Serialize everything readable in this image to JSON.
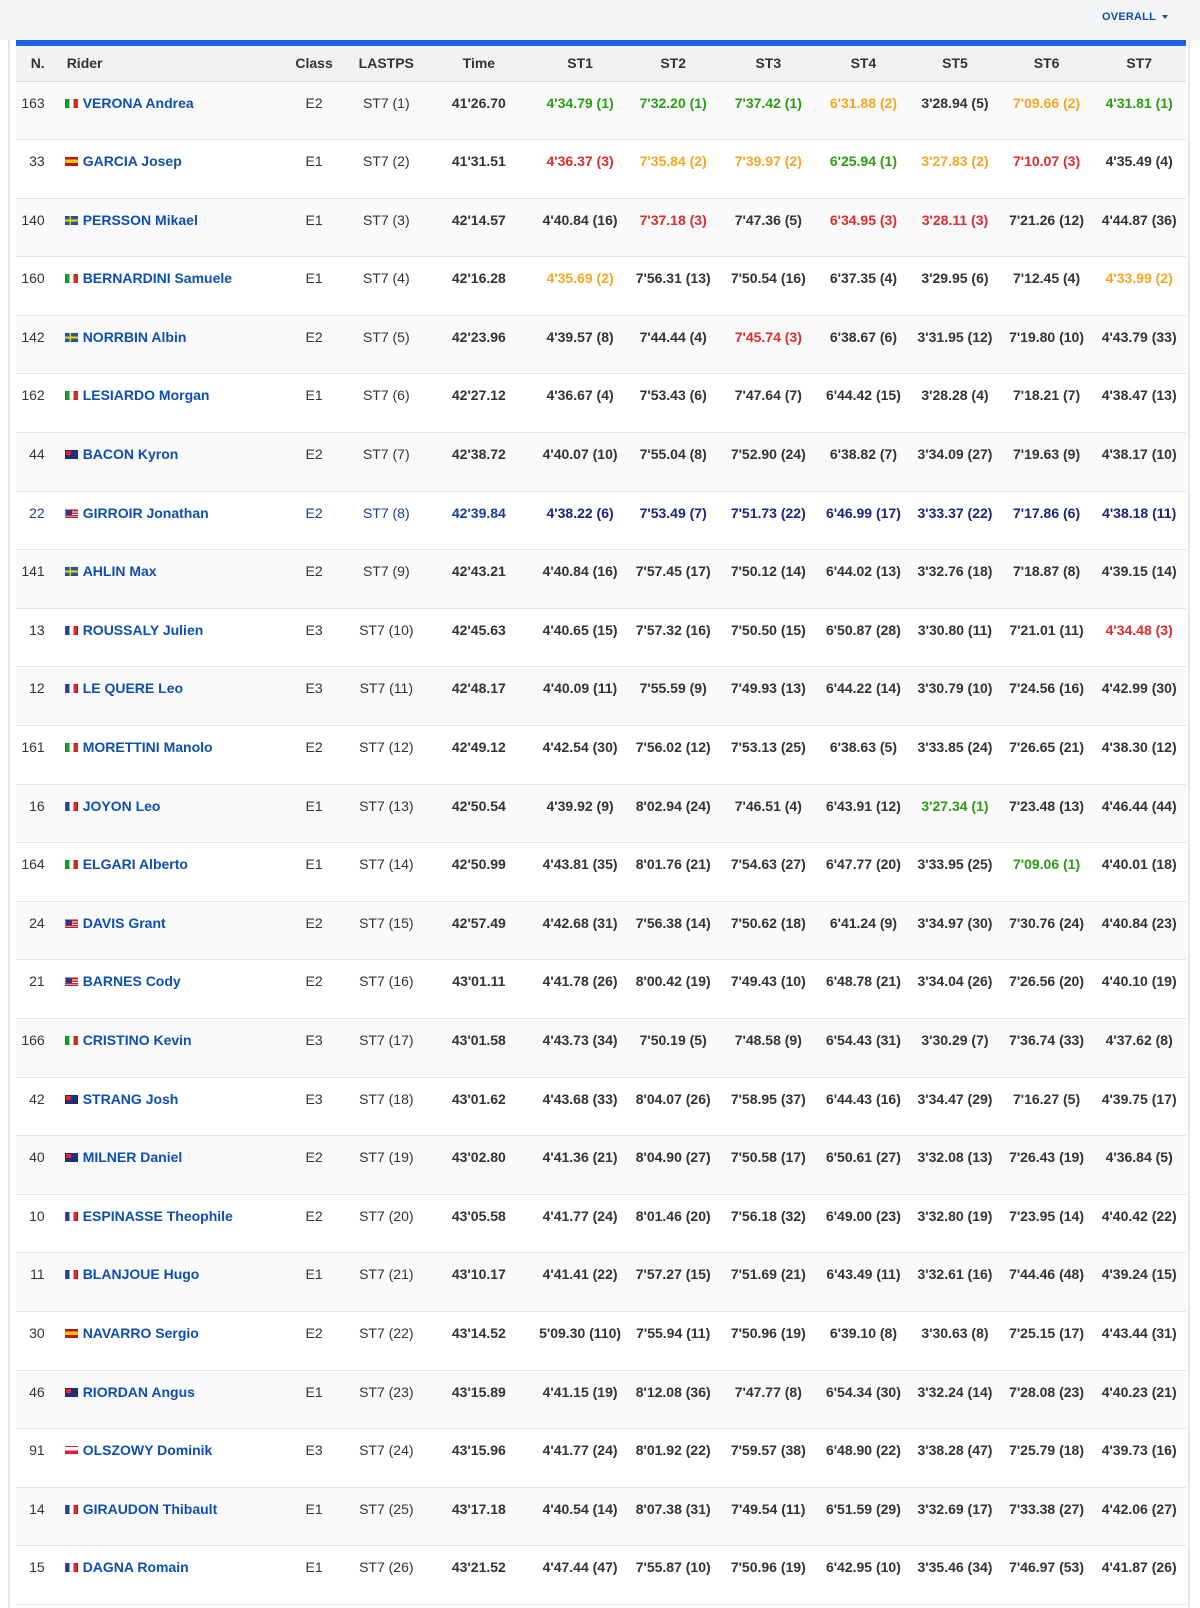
{
  "header": {
    "overall_label": "OVERALL"
  },
  "colors": {
    "accent": "#1c62e6",
    "link": "#0d4fb0",
    "first": "#2a9d12",
    "second": "#f5a623",
    "third": "#e02b2b",
    "highlight": "#1a237e"
  },
  "columns": [
    "N.",
    "Rider",
    "Class",
    "LASTPS",
    "Time",
    "ST1",
    "ST2",
    "ST3",
    "ST4",
    "ST5",
    "ST6",
    "ST7"
  ],
  "rows": [
    {
      "num": "163",
      "flag": "it",
      "rider": "VERONA Andrea",
      "cls": "E2",
      "lastps": "ST7 (1)",
      "time": "41'26.70",
      "st": [
        {
          "t": "4'34.79 (1)",
          "c": "green"
        },
        {
          "t": "7'32.20 (1)",
          "c": "green"
        },
        {
          "t": "7'37.42 (1)",
          "c": "green"
        },
        {
          "t": "6'31.88 (2)",
          "c": "orange"
        },
        {
          "t": "3'28.94 (5)",
          "c": ""
        },
        {
          "t": "7'09.66 (2)",
          "c": "orange"
        },
        {
          "t": "4'31.81 (1)",
          "c": "green"
        }
      ]
    },
    {
      "num": "33",
      "flag": "es",
      "rider": "GARCIA Josep",
      "cls": "E1",
      "lastps": "ST7 (2)",
      "time": "41'31.51",
      "st": [
        {
          "t": "4'36.37 (3)",
          "c": "red"
        },
        {
          "t": "7'35.84 (2)",
          "c": "orange"
        },
        {
          "t": "7'39.97 (2)",
          "c": "orange"
        },
        {
          "t": "6'25.94 (1)",
          "c": "green"
        },
        {
          "t": "3'27.83 (2)",
          "c": "orange"
        },
        {
          "t": "7'10.07 (3)",
          "c": "red"
        },
        {
          "t": "4'35.49 (4)",
          "c": ""
        }
      ]
    },
    {
      "num": "140",
      "flag": "se",
      "rider": "PERSSON Mikael",
      "cls": "E1",
      "lastps": "ST7 (3)",
      "time": "42'14.57",
      "st": [
        {
          "t": "4'40.84 (16)",
          "c": ""
        },
        {
          "t": "7'37.18 (3)",
          "c": "red"
        },
        {
          "t": "7'47.36 (5)",
          "c": ""
        },
        {
          "t": "6'34.95 (3)",
          "c": "red"
        },
        {
          "t": "3'28.11 (3)",
          "c": "red"
        },
        {
          "t": "7'21.26 (12)",
          "c": ""
        },
        {
          "t": "4'44.87 (36)",
          "c": ""
        }
      ]
    },
    {
      "num": "160",
      "flag": "it",
      "rider": "BERNARDINI Samuele",
      "cls": "E1",
      "lastps": "ST7 (4)",
      "time": "42'16.28",
      "st": [
        {
          "t": "4'35.69 (2)",
          "c": "orange"
        },
        {
          "t": "7'56.31 (13)",
          "c": ""
        },
        {
          "t": "7'50.54 (16)",
          "c": ""
        },
        {
          "t": "6'37.35 (4)",
          "c": ""
        },
        {
          "t": "3'29.95 (6)",
          "c": ""
        },
        {
          "t": "7'12.45 (4)",
          "c": ""
        },
        {
          "t": "4'33.99 (2)",
          "c": "orange"
        }
      ]
    },
    {
      "num": "142",
      "flag": "se",
      "rider": "NORRBIN Albin",
      "cls": "E2",
      "lastps": "ST7 (5)",
      "time": "42'23.96",
      "st": [
        {
          "t": "4'39.57 (8)",
          "c": ""
        },
        {
          "t": "7'44.44 (4)",
          "c": ""
        },
        {
          "t": "7'45.74 (3)",
          "c": "red"
        },
        {
          "t": "6'38.67 (6)",
          "c": ""
        },
        {
          "t": "3'31.95 (12)",
          "c": ""
        },
        {
          "t": "7'19.80 (10)",
          "c": ""
        },
        {
          "t": "4'43.79 (33)",
          "c": ""
        }
      ]
    },
    {
      "num": "162",
      "flag": "it",
      "rider": "LESIARDO Morgan",
      "cls": "E1",
      "lastps": "ST7 (6)",
      "time": "42'27.12",
      "st": [
        {
          "t": "4'36.67 (4)",
          "c": ""
        },
        {
          "t": "7'53.43 (6)",
          "c": ""
        },
        {
          "t": "7'47.64 (7)",
          "c": ""
        },
        {
          "t": "6'44.42 (15)",
          "c": ""
        },
        {
          "t": "3'28.28 (4)",
          "c": ""
        },
        {
          "t": "7'18.21 (7)",
          "c": ""
        },
        {
          "t": "4'38.47 (13)",
          "c": ""
        }
      ]
    },
    {
      "num": "44",
      "flag": "au",
      "rider": "BACON Kyron",
      "cls": "E2",
      "lastps": "ST7 (7)",
      "time": "42'38.72",
      "st": [
        {
          "t": "4'40.07 (10)",
          "c": ""
        },
        {
          "t": "7'55.04 (8)",
          "c": ""
        },
        {
          "t": "7'52.90 (24)",
          "c": ""
        },
        {
          "t": "6'38.82 (7)",
          "c": ""
        },
        {
          "t": "3'34.09 (27)",
          "c": ""
        },
        {
          "t": "7'19.63 (9)",
          "c": ""
        },
        {
          "t": "4'38.17 (10)",
          "c": ""
        }
      ]
    },
    {
      "num": "22",
      "flag": "us",
      "rider": "GIRROIR Jonathan",
      "cls": "E2",
      "lastps": "ST7 (8)",
      "time": "42'39.84",
      "highlight": true,
      "st": [
        {
          "t": "4'38.22 (6)",
          "c": "navy"
        },
        {
          "t": "7'53.49 (7)",
          "c": "navy"
        },
        {
          "t": "7'51.73 (22)",
          "c": "navy"
        },
        {
          "t": "6'46.99 (17)",
          "c": "navy"
        },
        {
          "t": "3'33.37 (22)",
          "c": "navy"
        },
        {
          "t": "7'17.86 (6)",
          "c": "navy"
        },
        {
          "t": "4'38.18 (11)",
          "c": "navy"
        }
      ]
    },
    {
      "num": "141",
      "flag": "se",
      "rider": "AHLIN Max",
      "cls": "E2",
      "lastps": "ST7 (9)",
      "time": "42'43.21",
      "st": [
        {
          "t": "4'40.84 (16)",
          "c": ""
        },
        {
          "t": "7'57.45 (17)",
          "c": ""
        },
        {
          "t": "7'50.12 (14)",
          "c": ""
        },
        {
          "t": "6'44.02 (13)",
          "c": ""
        },
        {
          "t": "3'32.76 (18)",
          "c": ""
        },
        {
          "t": "7'18.87 (8)",
          "c": ""
        },
        {
          "t": "4'39.15 (14)",
          "c": ""
        }
      ]
    },
    {
      "num": "13",
      "flag": "fr",
      "rider": "ROUSSALY Julien",
      "cls": "E3",
      "lastps": "ST7 (10)",
      "time": "42'45.63",
      "st": [
        {
          "t": "4'40.65 (15)",
          "c": ""
        },
        {
          "t": "7'57.32 (16)",
          "c": ""
        },
        {
          "t": "7'50.50 (15)",
          "c": ""
        },
        {
          "t": "6'50.87 (28)",
          "c": ""
        },
        {
          "t": "3'30.80 (11)",
          "c": ""
        },
        {
          "t": "7'21.01 (11)",
          "c": ""
        },
        {
          "t": "4'34.48 (3)",
          "c": "red"
        }
      ]
    },
    {
      "num": "12",
      "flag": "fr",
      "rider": "LE QUERE Leo",
      "cls": "E3",
      "lastps": "ST7 (11)",
      "time": "42'48.17",
      "st": [
        {
          "t": "4'40.09 (11)",
          "c": ""
        },
        {
          "t": "7'55.59 (9)",
          "c": ""
        },
        {
          "t": "7'49.93 (13)",
          "c": ""
        },
        {
          "t": "6'44.22 (14)",
          "c": ""
        },
        {
          "t": "3'30.79 (10)",
          "c": ""
        },
        {
          "t": "7'24.56 (16)",
          "c": ""
        },
        {
          "t": "4'42.99 (30)",
          "c": ""
        }
      ]
    },
    {
      "num": "161",
      "flag": "it",
      "rider": "MORETTINI Manolo",
      "cls": "E2",
      "lastps": "ST7 (12)",
      "time": "42'49.12",
      "st": [
        {
          "t": "4'42.54 (30)",
          "c": ""
        },
        {
          "t": "7'56.02 (12)",
          "c": ""
        },
        {
          "t": "7'53.13 (25)",
          "c": ""
        },
        {
          "t": "6'38.63 (5)",
          "c": ""
        },
        {
          "t": "3'33.85 (24)",
          "c": ""
        },
        {
          "t": "7'26.65 (21)",
          "c": ""
        },
        {
          "t": "4'38.30 (12)",
          "c": ""
        }
      ]
    },
    {
      "num": "16",
      "flag": "fr",
      "rider": "JOYON Leo",
      "cls": "E1",
      "lastps": "ST7 (13)",
      "time": "42'50.54",
      "st": [
        {
          "t": "4'39.92 (9)",
          "c": ""
        },
        {
          "t": "8'02.94 (24)",
          "c": ""
        },
        {
          "t": "7'46.51 (4)",
          "c": ""
        },
        {
          "t": "6'43.91 (12)",
          "c": ""
        },
        {
          "t": "3'27.34 (1)",
          "c": "green"
        },
        {
          "t": "7'23.48 (13)",
          "c": ""
        },
        {
          "t": "4'46.44 (44)",
          "c": ""
        }
      ]
    },
    {
      "num": "164",
      "flag": "it",
      "rider": "ELGARI Alberto",
      "cls": "E1",
      "lastps": "ST7 (14)",
      "time": "42'50.99",
      "st": [
        {
          "t": "4'43.81 (35)",
          "c": ""
        },
        {
          "t": "8'01.76 (21)",
          "c": ""
        },
        {
          "t": "7'54.63 (27)",
          "c": ""
        },
        {
          "t": "6'47.77 (20)",
          "c": ""
        },
        {
          "t": "3'33.95 (25)",
          "c": ""
        },
        {
          "t": "7'09.06 (1)",
          "c": "green"
        },
        {
          "t": "4'40.01 (18)",
          "c": ""
        }
      ]
    },
    {
      "num": "24",
      "flag": "us",
      "rider": "DAVIS Grant",
      "cls": "E2",
      "lastps": "ST7 (15)",
      "time": "42'57.49",
      "st": [
        {
          "t": "4'42.68 (31)",
          "c": ""
        },
        {
          "t": "7'56.38 (14)",
          "c": ""
        },
        {
          "t": "7'50.62 (18)",
          "c": ""
        },
        {
          "t": "6'41.24 (9)",
          "c": ""
        },
        {
          "t": "3'34.97 (30)",
          "c": ""
        },
        {
          "t": "7'30.76 (24)",
          "c": ""
        },
        {
          "t": "4'40.84 (23)",
          "c": ""
        }
      ]
    },
    {
      "num": "21",
      "flag": "us",
      "rider": "BARNES Cody",
      "cls": "E2",
      "lastps": "ST7 (16)",
      "time": "43'01.11",
      "st": [
        {
          "t": "4'41.78 (26)",
          "c": ""
        },
        {
          "t": "8'00.42 (19)",
          "c": ""
        },
        {
          "t": "7'49.43 (10)",
          "c": ""
        },
        {
          "t": "6'48.78 (21)",
          "c": ""
        },
        {
          "t": "3'34.04 (26)",
          "c": ""
        },
        {
          "t": "7'26.56 (20)",
          "c": ""
        },
        {
          "t": "4'40.10 (19)",
          "c": ""
        }
      ]
    },
    {
      "num": "166",
      "flag": "it",
      "rider": "CRISTINO Kevin",
      "cls": "E3",
      "lastps": "ST7 (17)",
      "time": "43'01.58",
      "st": [
        {
          "t": "4'43.73 (34)",
          "c": ""
        },
        {
          "t": "7'50.19 (5)",
          "c": ""
        },
        {
          "t": "7'48.58 (9)",
          "c": ""
        },
        {
          "t": "6'54.43 (31)",
          "c": ""
        },
        {
          "t": "3'30.29 (7)",
          "c": ""
        },
        {
          "t": "7'36.74 (33)",
          "c": ""
        },
        {
          "t": "4'37.62 (8)",
          "c": ""
        }
      ]
    },
    {
      "num": "42",
      "flag": "au",
      "rider": "STRANG Josh",
      "cls": "E3",
      "lastps": "ST7 (18)",
      "time": "43'01.62",
      "st": [
        {
          "t": "4'43.68 (33)",
          "c": ""
        },
        {
          "t": "8'04.07 (26)",
          "c": ""
        },
        {
          "t": "7'58.95 (37)",
          "c": ""
        },
        {
          "t": "6'44.43 (16)",
          "c": ""
        },
        {
          "t": "3'34.47 (29)",
          "c": ""
        },
        {
          "t": "7'16.27 (5)",
          "c": ""
        },
        {
          "t": "4'39.75 (17)",
          "c": ""
        }
      ]
    },
    {
      "num": "40",
      "flag": "au",
      "rider": "MILNER Daniel",
      "cls": "E2",
      "lastps": "ST7 (19)",
      "time": "43'02.80",
      "st": [
        {
          "t": "4'41.36 (21)",
          "c": ""
        },
        {
          "t": "8'04.90 (27)",
          "c": ""
        },
        {
          "t": "7'50.58 (17)",
          "c": ""
        },
        {
          "t": "6'50.61 (27)",
          "c": ""
        },
        {
          "t": "3'32.08 (13)",
          "c": ""
        },
        {
          "t": "7'26.43 (19)",
          "c": ""
        },
        {
          "t": "4'36.84 (5)",
          "c": ""
        }
      ]
    },
    {
      "num": "10",
      "flag": "fr",
      "rider": "ESPINASSE Theophile",
      "cls": "E2",
      "lastps": "ST7 (20)",
      "time": "43'05.58",
      "st": [
        {
          "t": "4'41.77 (24)",
          "c": ""
        },
        {
          "t": "8'01.46 (20)",
          "c": ""
        },
        {
          "t": "7'56.18 (32)",
          "c": ""
        },
        {
          "t": "6'49.00 (23)",
          "c": ""
        },
        {
          "t": "3'32.80 (19)",
          "c": ""
        },
        {
          "t": "7'23.95 (14)",
          "c": ""
        },
        {
          "t": "4'40.42 (22)",
          "c": ""
        }
      ]
    },
    {
      "num": "11",
      "flag": "fr",
      "rider": "BLANJOUE Hugo",
      "cls": "E1",
      "lastps": "ST7 (21)",
      "time": "43'10.17",
      "st": [
        {
          "t": "4'41.41 (22)",
          "c": ""
        },
        {
          "t": "7'57.27 (15)",
          "c": ""
        },
        {
          "t": "7'51.69 (21)",
          "c": ""
        },
        {
          "t": "6'43.49 (11)",
          "c": ""
        },
        {
          "t": "3'32.61 (16)",
          "c": ""
        },
        {
          "t": "7'44.46 (48)",
          "c": ""
        },
        {
          "t": "4'39.24 (15)",
          "c": ""
        }
      ]
    },
    {
      "num": "30",
      "flag": "es",
      "rider": "NAVARRO Sergio",
      "cls": "E2",
      "lastps": "ST7 (22)",
      "time": "43'14.52",
      "st": [
        {
          "t": "5'09.30 (110)",
          "c": ""
        },
        {
          "t": "7'55.94 (11)",
          "c": ""
        },
        {
          "t": "7'50.96 (19)",
          "c": ""
        },
        {
          "t": "6'39.10 (8)",
          "c": ""
        },
        {
          "t": "3'30.63 (8)",
          "c": ""
        },
        {
          "t": "7'25.15 (17)",
          "c": ""
        },
        {
          "t": "4'43.44 (31)",
          "c": ""
        }
      ]
    },
    {
      "num": "46",
      "flag": "au",
      "rider": "RIORDAN Angus",
      "cls": "E1",
      "lastps": "ST7 (23)",
      "time": "43'15.89",
      "st": [
        {
          "t": "4'41.15 (19)",
          "c": ""
        },
        {
          "t": "8'12.08 (36)",
          "c": ""
        },
        {
          "t": "7'47.77 (8)",
          "c": ""
        },
        {
          "t": "6'54.34 (30)",
          "c": ""
        },
        {
          "t": "3'32.24 (14)",
          "c": ""
        },
        {
          "t": "7'28.08 (23)",
          "c": ""
        },
        {
          "t": "4'40.23 (21)",
          "c": ""
        }
      ]
    },
    {
      "num": "91",
      "flag": "pl",
      "rider": "OLSZOWY Dominik",
      "cls": "E3",
      "lastps": "ST7 (24)",
      "time": "43'15.96",
      "st": [
        {
          "t": "4'41.77 (24)",
          "c": ""
        },
        {
          "t": "8'01.92 (22)",
          "c": ""
        },
        {
          "t": "7'59.57 (38)",
          "c": ""
        },
        {
          "t": "6'48.90 (22)",
          "c": ""
        },
        {
          "t": "3'38.28 (47)",
          "c": ""
        },
        {
          "t": "7'25.79 (18)",
          "c": ""
        },
        {
          "t": "4'39.73 (16)",
          "c": ""
        }
      ]
    },
    {
      "num": "14",
      "flag": "fr",
      "rider": "GIRAUDON Thibault",
      "cls": "E1",
      "lastps": "ST7 (25)",
      "time": "43'17.18",
      "st": [
        {
          "t": "4'40.54 (14)",
          "c": ""
        },
        {
          "t": "8'07.38 (31)",
          "c": ""
        },
        {
          "t": "7'49.54 (11)",
          "c": ""
        },
        {
          "t": "6'51.59 (29)",
          "c": ""
        },
        {
          "t": "3'32.69 (17)",
          "c": ""
        },
        {
          "t": "7'33.38 (27)",
          "c": ""
        },
        {
          "t": "4'42.06 (27)",
          "c": ""
        }
      ]
    },
    {
      "num": "15",
      "flag": "fr",
      "rider": "DAGNA Romain",
      "cls": "E1",
      "lastps": "ST7 (26)",
      "time": "43'21.52",
      "st": [
        {
          "t": "4'47.44 (47)",
          "c": ""
        },
        {
          "t": "7'55.87 (10)",
          "c": ""
        },
        {
          "t": "7'50.96 (19)",
          "c": ""
        },
        {
          "t": "6'42.95 (10)",
          "c": ""
        },
        {
          "t": "3'35.46 (34)",
          "c": ""
        },
        {
          "t": "7'46.97 (53)",
          "c": ""
        },
        {
          "t": "4'41.87 (26)",
          "c": ""
        }
      ]
    }
  ]
}
